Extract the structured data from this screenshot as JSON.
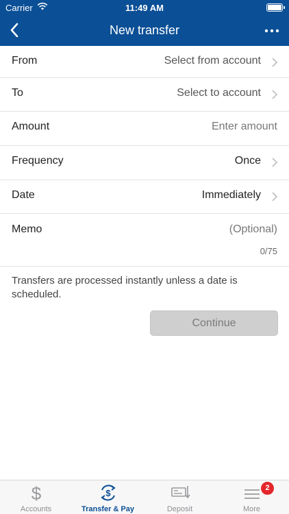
{
  "status_bar": {
    "carrier": "Carrier",
    "time": "11:49 AM"
  },
  "nav": {
    "title": "New transfer"
  },
  "form": {
    "from": {
      "label": "From",
      "value": "Select from account"
    },
    "to": {
      "label": "To",
      "value": "Select to account"
    },
    "amount": {
      "label": "Amount",
      "placeholder": "Enter amount"
    },
    "frequency": {
      "label": "Frequency",
      "value": "Once"
    },
    "date": {
      "label": "Date",
      "value": "Immediately"
    },
    "memo": {
      "label": "Memo",
      "placeholder": "(Optional)",
      "count": "0/75"
    }
  },
  "note": "Transfers are processed instantly unless a date is scheduled.",
  "continue_label": "Continue",
  "tabs": [
    {
      "label": "Accounts",
      "icon": "dollar-icon",
      "active": false
    },
    {
      "label": "Transfer & Pay",
      "icon": "transfer-dollar-icon",
      "active": true
    },
    {
      "label": "Deposit",
      "icon": "check-deposit-icon",
      "active": false
    },
    {
      "label": "More",
      "icon": "menu-icon",
      "active": false,
      "badge": "2"
    }
  ],
  "colors": {
    "brand": "#0b4f96",
    "badge": "#e4262b",
    "disabled_button": "#cfcfcf"
  }
}
